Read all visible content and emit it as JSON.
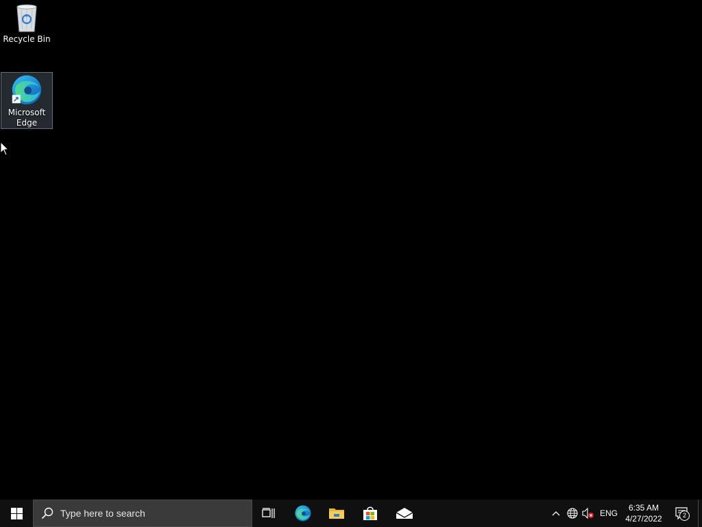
{
  "desktop": {
    "icons": [
      {
        "label": "Recycle Bin",
        "icon": "recycle-bin-icon"
      },
      {
        "label": "Microsoft\nEdge",
        "icon": "edge-icon",
        "selected": true
      }
    ]
  },
  "taskbar": {
    "search": {
      "placeholder": "Type here to search"
    },
    "pinned": [
      {
        "name": "Task View",
        "icon": "task-view-icon"
      },
      {
        "name": "Microsoft Edge",
        "icon": "edge-icon"
      },
      {
        "name": "File Explorer",
        "icon": "folder-icon"
      },
      {
        "name": "Microsoft Store",
        "icon": "store-icon"
      },
      {
        "name": "Mail",
        "icon": "mail-icon"
      }
    ],
    "tray": {
      "language": "ENG",
      "time": "6:35 AM",
      "date": "4/27/2022",
      "notification_count": "2"
    }
  },
  "colors": {
    "desktop_bg": "#000000",
    "taskbar_bg": "#101010",
    "accent": "#0078d7"
  }
}
